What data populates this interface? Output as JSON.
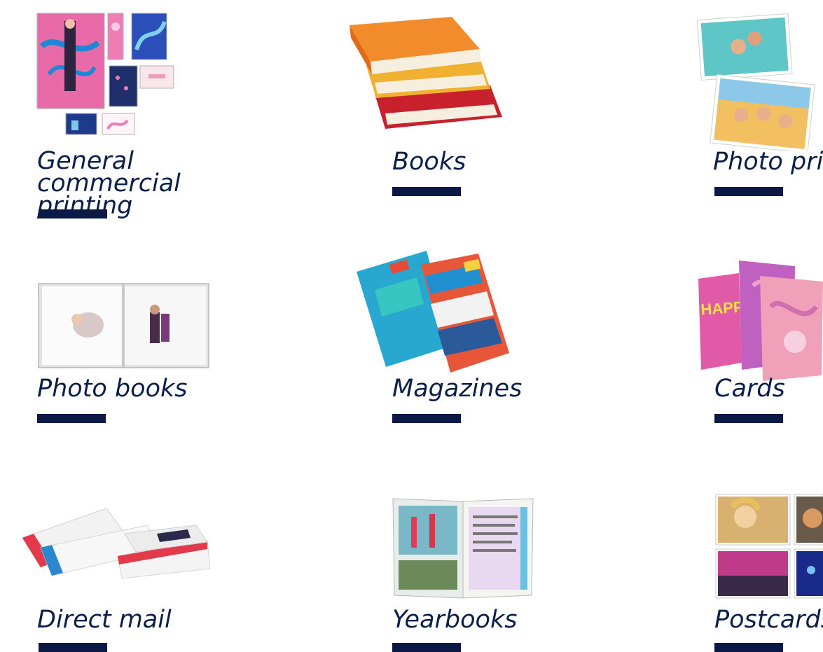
{
  "colors": {
    "label": "#0a1f4a",
    "bar": "#0a1a44",
    "background": "#ffffff"
  },
  "tiles": [
    {
      "label": "General commercial\nprinting",
      "icon": "commercial-print-collage-icon"
    },
    {
      "label": "Books",
      "icon": "stacked-books-icon"
    },
    {
      "label": "Photo prints",
      "icon": "photo-prints-icon"
    },
    {
      "label": "Photo books",
      "icon": "open-photo-book-icon"
    },
    {
      "label": "Magazines",
      "icon": "magazines-icon"
    },
    {
      "label": "Cards",
      "icon": "greeting-cards-icon"
    },
    {
      "label": "Direct mail",
      "icon": "direct-mail-envelopes-icon"
    },
    {
      "label": "Yearbooks",
      "icon": "open-yearbook-icon"
    },
    {
      "label": "Postcards",
      "icon": "postcards-grid-icon"
    }
  ]
}
